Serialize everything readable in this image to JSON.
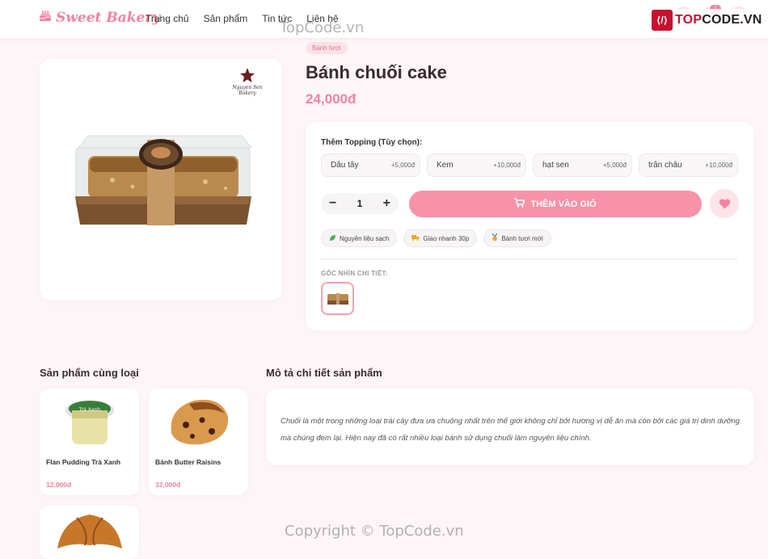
{
  "header": {
    "logo_text": "Sweet Bakery",
    "nav": [
      "Trang chủ",
      "Sản phẩm",
      "Tin tức",
      "Liên hệ"
    ],
    "cart_count": "1"
  },
  "watermark": {
    "brand_top": "TOPCODE.VN",
    "brand_prefix": "TOP",
    "brand_suffix": "CODE.VN",
    "topcode": "TopCode.vn",
    "copyright": "Copyright © TopCode.vn"
  },
  "product": {
    "category": "Bánh tươi",
    "title": "Bánh chuối cake",
    "price": "24,000đ",
    "brand_logo_line1": "Nguyen Sen",
    "brand_logo_line2": "Bakery",
    "topping_label": "Thêm Topping (Tùy chọn):",
    "toppings": [
      {
        "name": "Dâu tây",
        "price": "+5,000đ"
      },
      {
        "name": "Kem",
        "price": "+10,000đ"
      },
      {
        "name": "hạt sen",
        "price": "+5,000đ"
      },
      {
        "name": "trân châu",
        "price": "+10,000đ"
      }
    ],
    "quantity": "1",
    "add_to_cart": "THÊM VÀO GIỎ",
    "features": [
      "Nguyên liệu sạch",
      "Giao nhanh 30p",
      "Bánh tươi mới"
    ],
    "view_label": "GÓC NHÌN CHI TIẾT:"
  },
  "related": {
    "title": "Sản phẩm cùng loại",
    "items": [
      {
        "name": "Flan Pudding Trà Xanh",
        "price": "12,000đ"
      },
      {
        "name": "Bánh Butter Raisins",
        "price": "32,000đ"
      }
    ]
  },
  "description": {
    "title": "Mô tả chi tiết sản phẩm",
    "text": "Chuối là một trong những loại trái cây đựa ưa chuộng nhất trên thế giới  không chỉ bởi hương vị dễ ăn mà còn bởi các giá trị dinh dưỡng mà chúng đem lại. Hiện nay đã có rất nhiều loại bánh sử dụng chuối làm nguyên liệu chính."
  },
  "colors": {
    "accent": "#f0849f",
    "button": "#f892a9",
    "background": "#fdf5f7"
  }
}
